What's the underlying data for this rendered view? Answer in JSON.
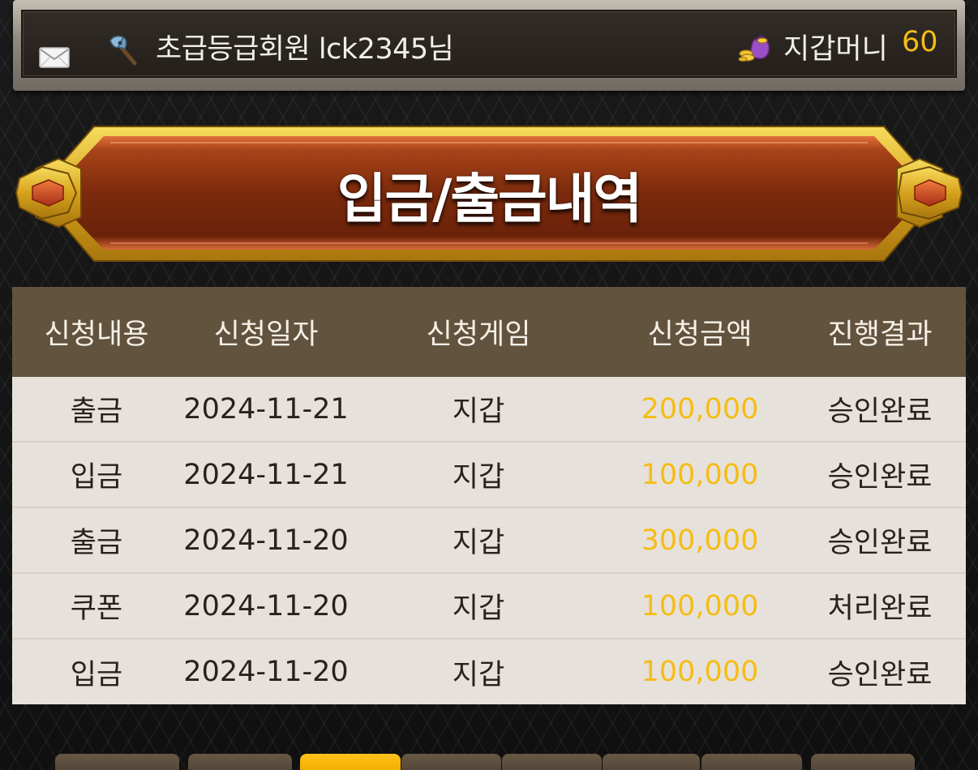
{
  "header": {
    "grade": "초급등급회원",
    "user_id": "lck2345님",
    "wallet_label": "지갑머니",
    "wallet_amount": "60",
    "icons": {
      "mail": "mail-icon",
      "grade": "axe-icon",
      "wallet": "coin-pouch-icon"
    }
  },
  "banner": {
    "title": "입금/출금내역"
  },
  "table": {
    "headers": [
      "신청내용",
      "신청일자",
      "신청게임",
      "신청금액",
      "진행결과"
    ],
    "rows": [
      {
        "type": "출금",
        "date": "2024-11-21",
        "game": "지갑",
        "amount": "200,000",
        "status": "승인완료"
      },
      {
        "type": "입금",
        "date": "2024-11-21",
        "game": "지갑",
        "amount": "100,000",
        "status": "승인완료"
      },
      {
        "type": "출금",
        "date": "2024-11-20",
        "game": "지갑",
        "amount": "300,000",
        "status": "승인완료"
      },
      {
        "type": "쿠폰",
        "date": "2024-11-20",
        "game": "지갑",
        "amount": "100,000",
        "status": "처리완료"
      },
      {
        "type": "입금",
        "date": "2024-11-20",
        "game": "지갑",
        "amount": "100,000",
        "status": "승인완료"
      }
    ]
  },
  "pagination": {
    "page_count": 8,
    "active_index": 2
  },
  "colors": {
    "accent": "#f5bd14",
    "header_bg": "#62533f",
    "row_bg": "#e7e1db",
    "banner_red": "#8a2e0e",
    "gold": "#d9a520"
  }
}
